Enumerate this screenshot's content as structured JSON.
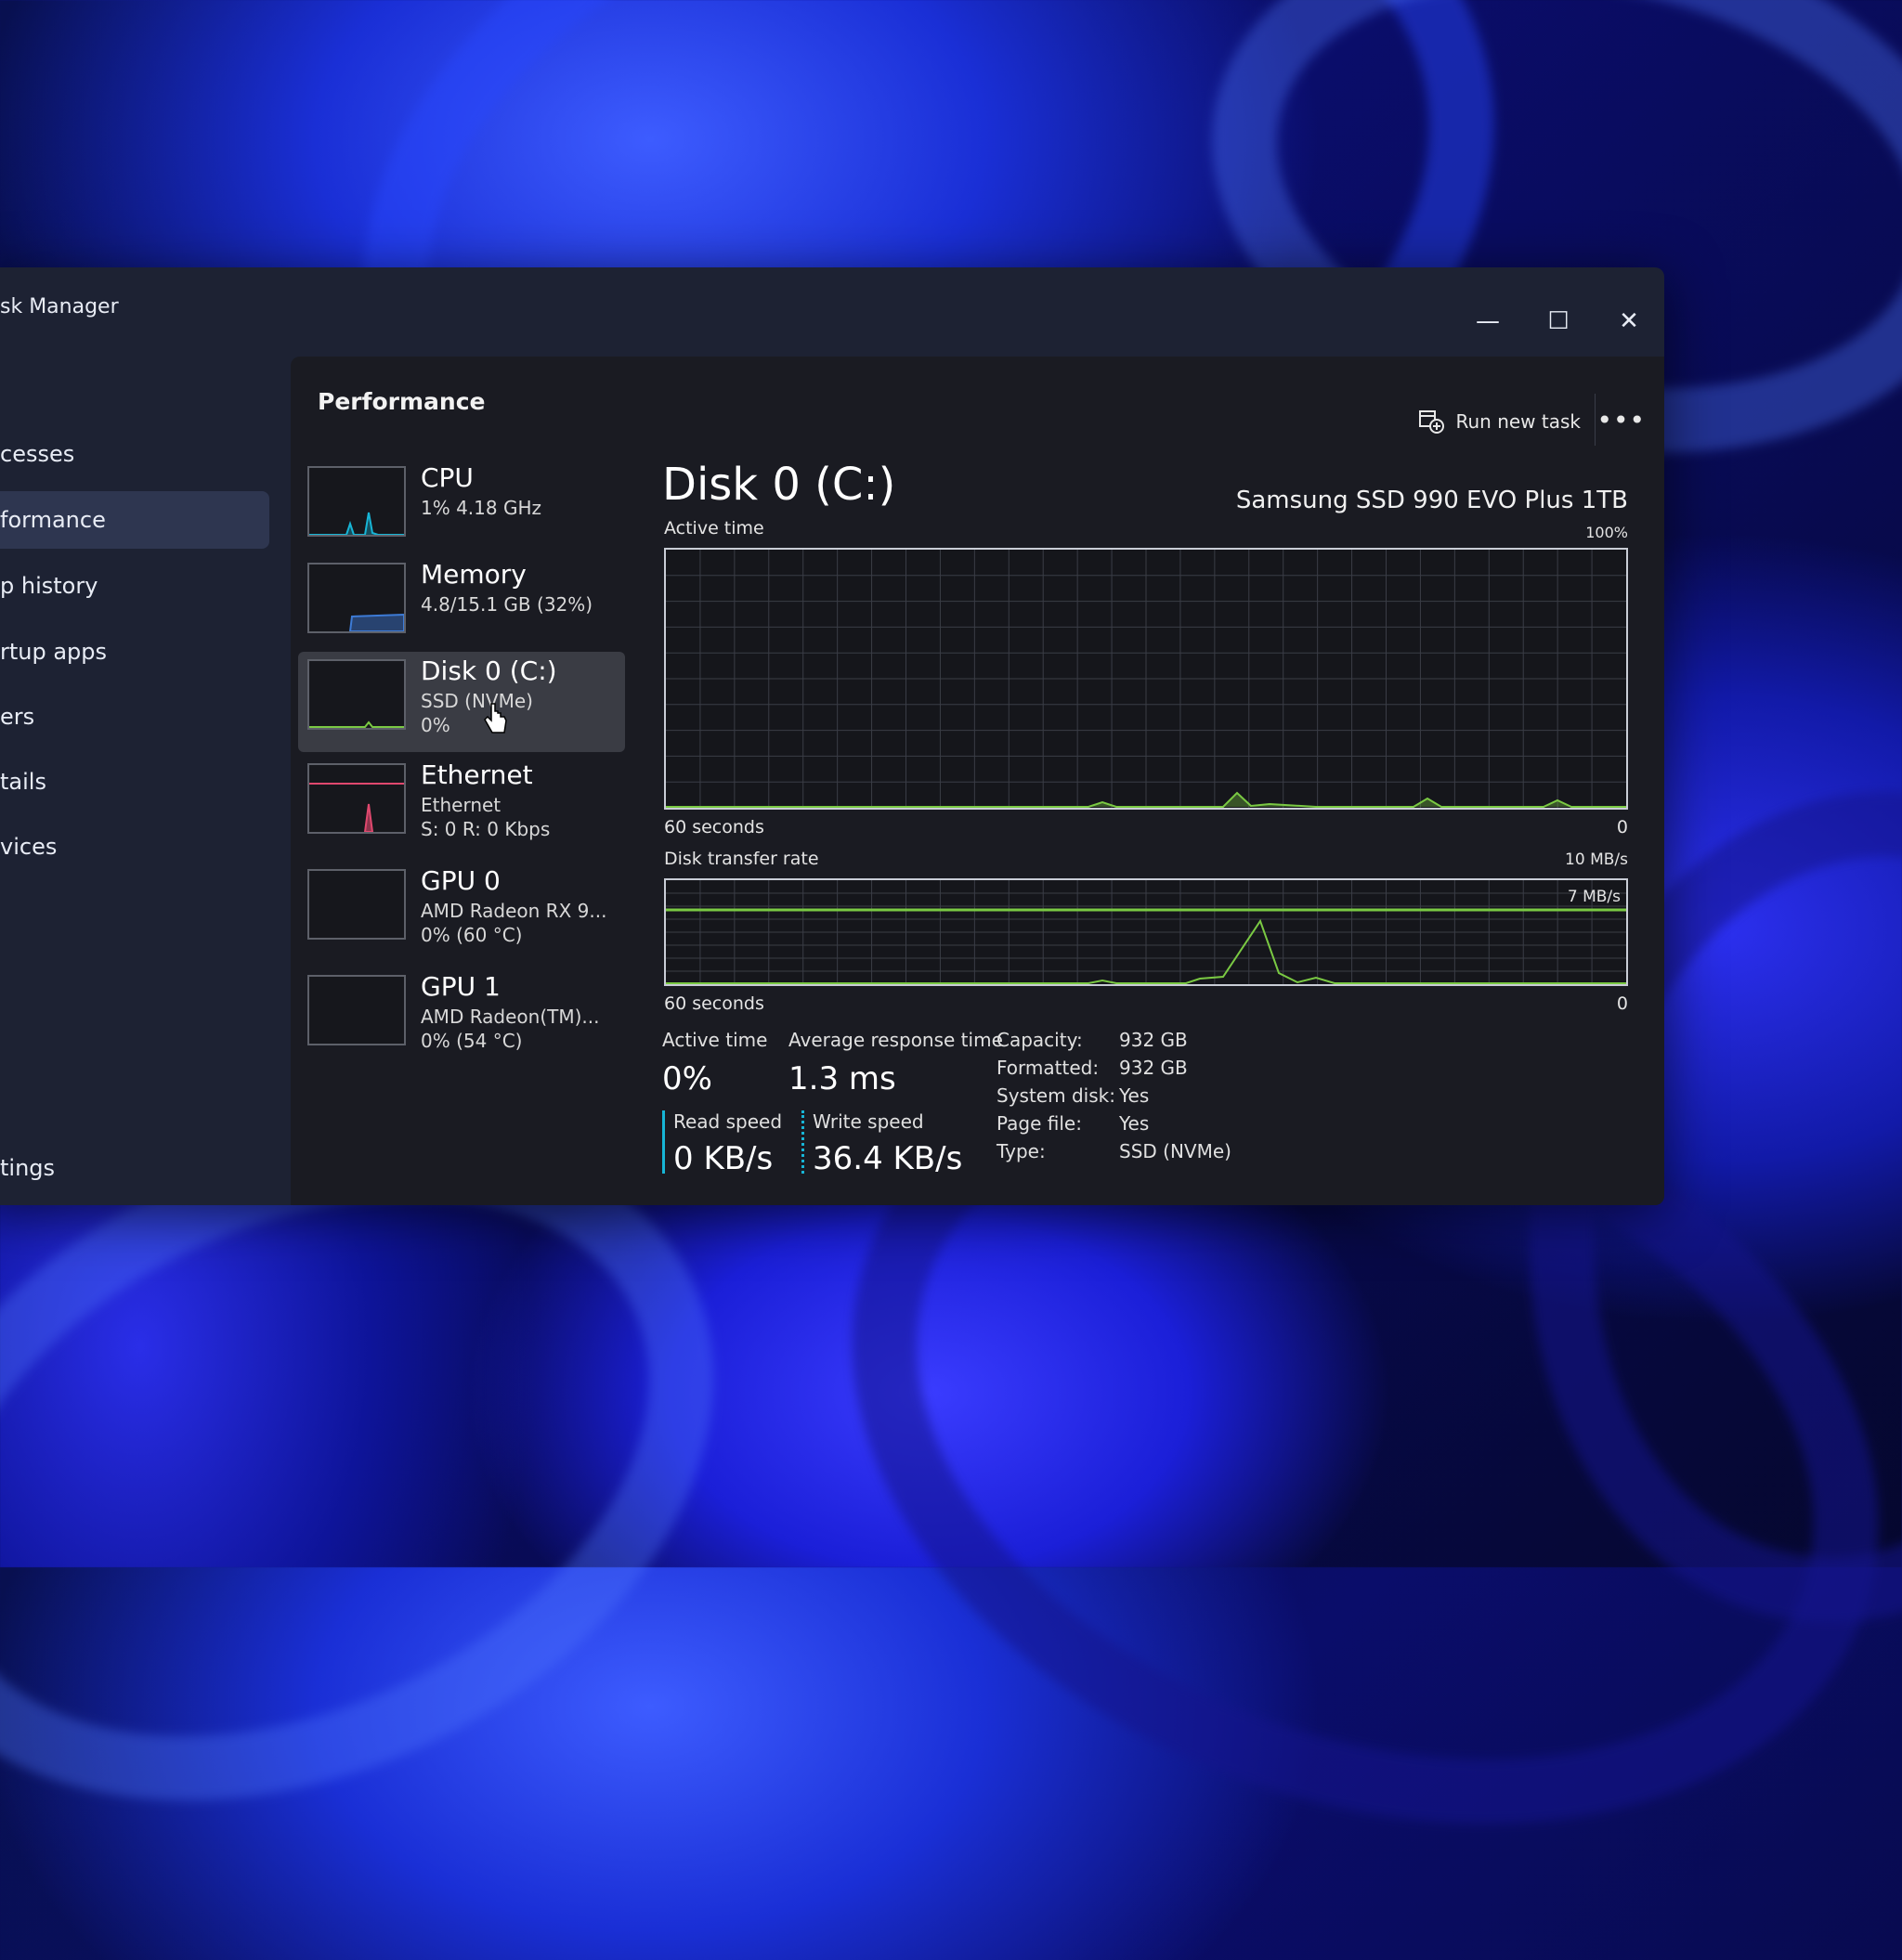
{
  "window": {
    "title": "sk Manager",
    "controls": {
      "minimize": "—",
      "maximize": "☐",
      "close": "✕"
    }
  },
  "nav": [
    {
      "label": "cesses"
    },
    {
      "label": "formance"
    },
    {
      "label": "p history"
    },
    {
      "label": "rtup apps"
    },
    {
      "label": "ers"
    },
    {
      "label": "tails"
    },
    {
      "label": "vices"
    },
    {
      "label": "tings"
    }
  ],
  "performance": {
    "title": "Performance",
    "run_new_task": "Run new task",
    "more": "•••"
  },
  "devices": [
    {
      "name": "CPU",
      "line1": "1% 4.18 GHz",
      "line2": "",
      "line3": "",
      "color": "#17b5d6"
    },
    {
      "name": "Memory",
      "line1": "4.8/15.1 GB (32%)",
      "line2": "",
      "line3": "",
      "color": "#3d7bd6"
    },
    {
      "name": "Disk 0 (C:)",
      "line1": "SSD (NVMe)",
      "line2": "0%",
      "line3": "",
      "color": "#7ac943"
    },
    {
      "name": "Ethernet",
      "line1": "Ethernet",
      "line2": "S: 0 R: 0 Kbps",
      "line3": "",
      "color": "#e0486e"
    },
    {
      "name": "GPU 0",
      "line1": "AMD Radeon RX 9...",
      "line2": "0% (60 °C)",
      "line3": "",
      "color": "#888888"
    },
    {
      "name": "GPU 1",
      "line1": "AMD Radeon(TM)...",
      "line2": "0% (54 °C)",
      "line3": "",
      "color": "#888888"
    }
  ],
  "detail": {
    "title": "Disk 0 (C:)",
    "model": "Samsung SSD 990 EVO Plus 1TB",
    "active_time_label": "Active time",
    "active_time_max": "100%",
    "active_time_window": "60 seconds",
    "active_time_min": "0",
    "transfer_label": "Disk transfer rate",
    "transfer_max": "10 MB/s",
    "transfer_line": "7 MB/s",
    "transfer_window": "60 seconds",
    "transfer_min": "0",
    "accent": "#7ac943",
    "stats": {
      "active_time_label": "Active time",
      "active_time_value": "0%",
      "avg_response_label": "Average response time",
      "avg_response_value": "1.3 ms",
      "read_label": "Read speed",
      "read_value": "0 KB/s",
      "write_label": "Write speed",
      "write_value": "36.4 KB/s"
    },
    "props": [
      {
        "k": "Capacity:",
        "v": "932 GB"
      },
      {
        "k": "Formatted:",
        "v": "932 GB"
      },
      {
        "k": "System disk:",
        "v": "Yes"
      },
      {
        "k": "Page file:",
        "v": "Yes"
      },
      {
        "k": "Type:",
        "v": "SSD (NVMe)"
      }
    ]
  }
}
